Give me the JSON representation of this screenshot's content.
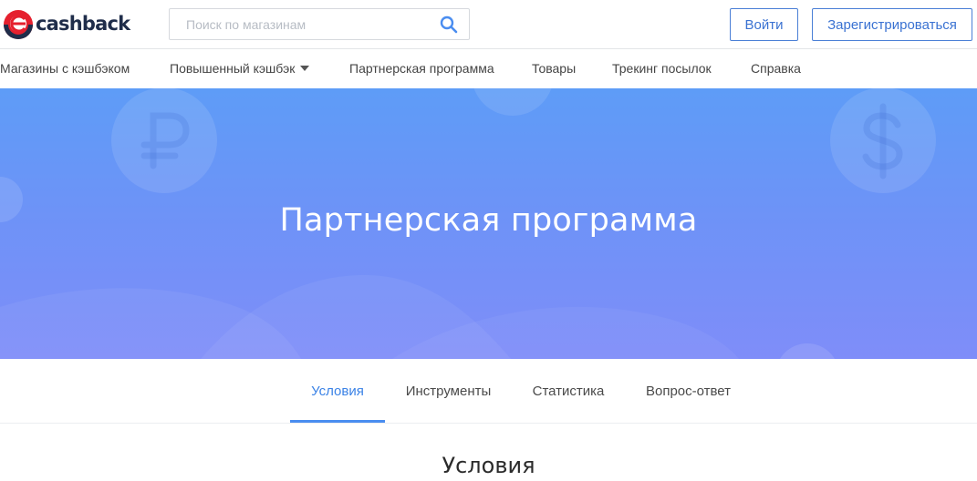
{
  "header": {
    "logo_text": "cashback",
    "search": {
      "placeholder": "Поиск по магазинам"
    },
    "login_label": "Войти",
    "register_label": "Зарегистрироваться"
  },
  "nav": {
    "items": [
      {
        "label": "Магазины с кэшбэком"
      },
      {
        "label": "Повышенный кэшбэк",
        "has_dropdown": true
      },
      {
        "label": "Партнерская программа"
      },
      {
        "label": "Товары"
      },
      {
        "label": "Трекинг посылок"
      },
      {
        "label": "Справка"
      }
    ]
  },
  "hero": {
    "title": "Партнерская программа",
    "decor_icons": [
      "ruble-coin-icon",
      "dollar-coin-icon"
    ]
  },
  "tabs": {
    "items": [
      {
        "label": "Условия",
        "active": true
      },
      {
        "label": "Инструменты"
      },
      {
        "label": "Статистика"
      },
      {
        "label": "Вопрос-ответ"
      }
    ]
  },
  "section": {
    "title": "Условия"
  },
  "colors": {
    "brand_red": "#e5202e",
    "brand_navy": "#1f2d4a",
    "accent_blue": "#3a82e6",
    "hero_gradient_top": "#5e9cf7",
    "hero_gradient_bottom": "#7f8df9"
  }
}
